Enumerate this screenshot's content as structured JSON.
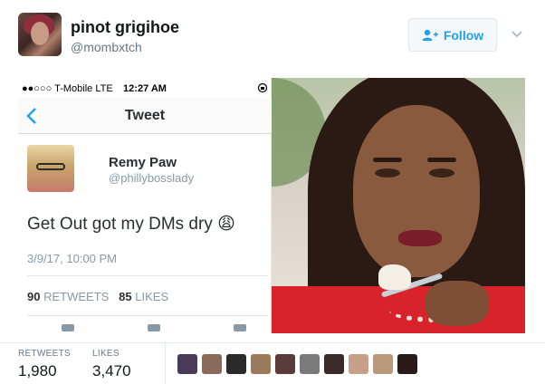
{
  "author": {
    "display_name": "pinot grigihoe",
    "handle": "@mombxtch"
  },
  "follow_button": {
    "label": "Follow"
  },
  "colors": {
    "accent": "#1da1f2",
    "muted": "#657786"
  },
  "media": {
    "phone_screenshot": {
      "status_bar": {
        "carrier": "●●○○○ T-Mobile  LTE",
        "time": "12:27 AM"
      },
      "nav_title": "Tweet",
      "quoted_tweet": {
        "display_name": "Remy Paw",
        "handle": "@phillybosslady",
        "text": "Get Out got my DMs dry 😩",
        "date": "3/9/17, 10:00 PM",
        "retweets_count": "90",
        "retweets_label": "RETWEETS",
        "likes_count": "85",
        "likes_label": "LIKES"
      }
    }
  },
  "stats": {
    "retweets_label": "RETWEETS",
    "retweets_value": "1,980",
    "likes_label": "LIKES",
    "likes_value": "3,470"
  },
  "liker_avatars": [
    "#4a3a5a",
    "#8a6a5a",
    "#2a2a2a",
    "#9a7a5a",
    "#5a3a3a",
    "#7a7a7a",
    "#3a2a2a",
    "#c8a08a",
    "#b89a7a",
    "#2a1a1a"
  ]
}
